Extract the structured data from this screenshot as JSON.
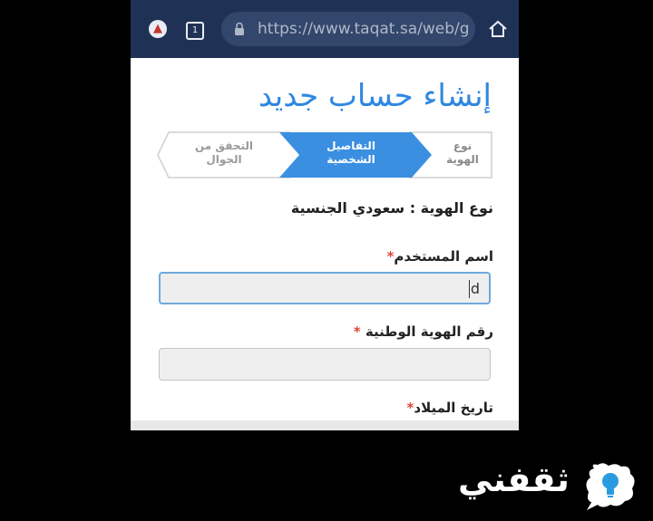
{
  "browser": {
    "url": "https://www.taqat.sa/web/g",
    "tab_count": "1",
    "colors": {
      "bar": "#1f3256",
      "url_box": "#33466b"
    }
  },
  "page": {
    "title": "إنشاء حساب جديد",
    "accent_color": "#2f88e0",
    "steps": [
      {
        "line1": "نوع",
        "line2": "الهوية",
        "state": "done"
      },
      {
        "line1": "التفاصيل",
        "line2": "الشخصية",
        "state": "active"
      },
      {
        "line1": "التحقق من",
        "line2": "الجوال",
        "state": "pending"
      }
    ],
    "id_type_text": "نوع الهوية : سعودي الجنسية",
    "fields": {
      "username": {
        "label": "اسم المستخدم",
        "required": "*",
        "value": "d"
      },
      "national_id": {
        "label": "رقم الهوية الوطنية",
        "required": "*",
        "value": ""
      },
      "birth_date": {
        "label": "تاريخ الميلاد",
        "required": "*"
      }
    }
  },
  "watermark": {
    "text": "ثقفني",
    "logo": "lightbulb-speech-bubble-icon"
  }
}
